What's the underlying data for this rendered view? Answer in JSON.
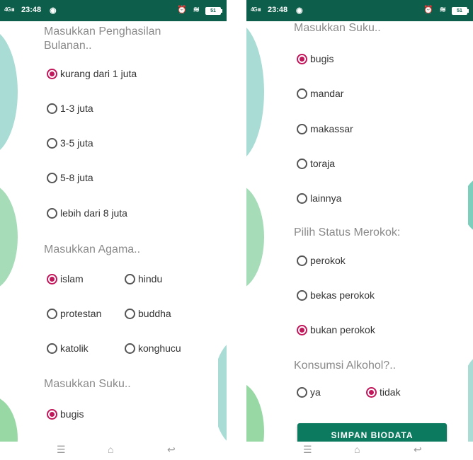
{
  "status_bar": {
    "network": "4G",
    "signal": "ııı",
    "time": "23:48",
    "battery": "51"
  },
  "left_screen": {
    "income": {
      "label": "Masukkan Penghasilan Bulanan..",
      "options": [
        "kurang dari 1 juta",
        "1-3 juta",
        "3-5 juta",
        "5-8 juta",
        "lebih dari 8 juta"
      ],
      "selected": "kurang dari 1 juta"
    },
    "religion": {
      "label": "Masukkan Agama..",
      "options": [
        "islam",
        "hindu",
        "protestan",
        "buddha",
        "katolik",
        "konghucu"
      ],
      "selected": "islam"
    },
    "ethnicity": {
      "label": "Masukkan Suku..",
      "options": [
        "bugis"
      ],
      "selected": "bugis"
    }
  },
  "right_screen": {
    "ethnicity": {
      "label": "Masukkan Suku..",
      "options": [
        "bugis",
        "mandar",
        "makassar",
        "toraja",
        "lainnya"
      ],
      "selected": "bugis"
    },
    "smoking": {
      "label": "Pilih Status Merokok:",
      "options": [
        "perokok",
        "bekas perokok",
        "bukan perokok"
      ],
      "selected": "bukan perokok"
    },
    "alcohol": {
      "label": "Konsumsi Alkohol?..",
      "options": [
        "ya",
        "tidak"
      ],
      "selected": "tidak"
    },
    "save_button": "SIMPAN BIODATA"
  },
  "nav_icons": [
    "menu-icon",
    "home-icon",
    "back-icon"
  ],
  "colors": {
    "status_bar": "#0d5e4a",
    "accent": "#c2185b",
    "button": "#0b7a5f",
    "decor_teal": "#a8dcd5",
    "decor_green": "#a6dcb8"
  }
}
